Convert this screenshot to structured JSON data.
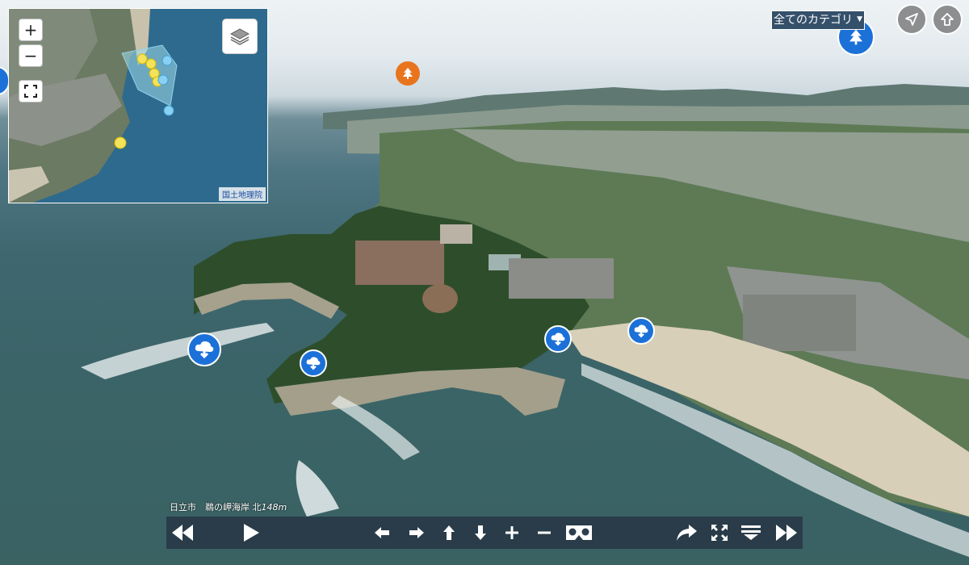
{
  "map": {
    "zoom_in_label": "+",
    "zoom_out_label": "−",
    "attribution": "国土地理院",
    "fullscreen_icon": "fullscreen-icon",
    "layers_icon": "layers-icon"
  },
  "category_select": {
    "selected": "全てのカテゴリ",
    "caret": "▼"
  },
  "top_buttons": [
    {
      "name": "navigate-button",
      "icon": "navigation-arrow-icon"
    },
    {
      "name": "up-button",
      "icon": "up-arrow-icon"
    }
  ],
  "caption": {
    "place": "日立市　鵜の岬海岸",
    "direction": "北",
    "distance": "148m"
  },
  "toolbar": {
    "buttons": [
      "rewind",
      "play",
      "left",
      "right",
      "up",
      "down",
      "zoom-in",
      "zoom-out",
      "vr",
      "share",
      "fullscreen",
      "menu",
      "fast-forward"
    ]
  },
  "colors": {
    "hotspot_blue": "#1c71d8",
    "hotspot_orange": "#e8741e",
    "toolbar_bg": "#2d3e4f",
    "category_bg": "#35506a"
  }
}
